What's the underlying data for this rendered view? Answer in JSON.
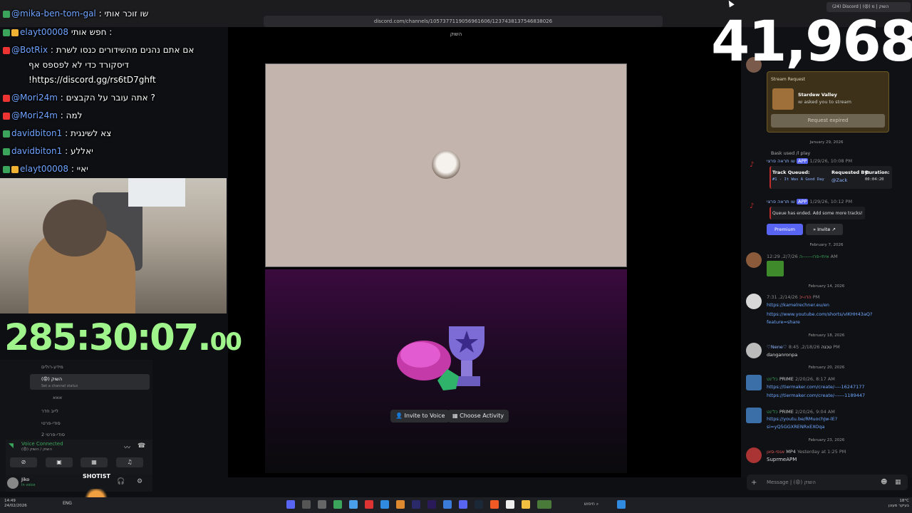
{
  "browser": {
    "url": "discord.com/channels/1057377119056961606/1237438137546838026",
    "tab_title": "(24) Discord | (😡) השוק | מ"
  },
  "voice": {
    "channel_header": "השוק",
    "invite_label": "Invite to Voice",
    "activity_label": "Choose Activity"
  },
  "overlay": {
    "counter": "41,968",
    "timer_main": "285:30:07.",
    "timer_frac": "00",
    "chat": [
      {
        "user": "@mika-ben-tom-gal",
        "text": ": שו זוכר אותי"
      },
      {
        "user": "elayt00008",
        "text": "חפש אותי :"
      },
      {
        "user": "@BotRix",
        "text": ": אם אתם נהנים מהשידורים כנסו לשרת"
      },
      {
        "user": "",
        "text": "דיסקורד כדי לא לפספס אף"
      },
      {
        "user": "",
        "text": "!https://discord.gg/rs6tD7ghft"
      },
      {
        "user": "@Mori24m",
        "text": ": אתה עובר על הקבצים ?"
      },
      {
        "user": "@Mori24m",
        "text": ": למה"
      },
      {
        "user": "davidbiton1",
        "text": ": צא לשינגית"
      },
      {
        "user": "davidbiton1",
        "text": ": יאללע"
      },
      {
        "user": "elayt00008",
        "text": ": יאיי"
      }
    ]
  },
  "chat": {
    "stream_request_title": "Stream Request",
    "stream_game": "Stardew Valley",
    "stream_asked": "שו asked you to stream",
    "request_expired": "Request expired",
    "dates": [
      "January 29, 2026",
      "February 7, 2026",
      "February 14, 2026",
      "February 18, 2026",
      "February 20, 2026",
      "February 23, 2026"
    ],
    "bask_used": "Bask used /l play",
    "bot_name": "שו תראה פרצי",
    "app_tag": "APP",
    "time1": "1/29/26, 10:08 PM",
    "time2": "1/29/26, 10:12 PM",
    "track_queued": "Track Queued:",
    "requested_by": "Requested By:",
    "duration": "Duration:",
    "track_name": "#1 - It Was A Good Day",
    "requester": "@Zack",
    "track_duration": "00:04:20",
    "queue_ended": "Queue has ended. Add some more tracks!",
    "premium": "Premium",
    "invite": "Invite",
    "user3": "איתי-פרו------ה",
    "time3": "2/7/26, 12:29 AM",
    "user4": "הדו-יכ",
    "time4": "2/14/26, 7:31 PM",
    "link1": "https://kamelrechner.eu/en",
    "link2": "https://www.youtube.com/shorts/vIKHH43aQ?",
    "link2b": "feature=share",
    "user5": "♡Nene♡",
    "tag5": "טכנה",
    "time5": "2/18/26, 8:45 PM",
    "msg5": "danganronpa",
    "user6": "כל'נט",
    "tag6": "PRIME",
    "time6": "2/20/26, 8:17 AM",
    "link3": "https://tiermaker.com/create/----16247177",
    "link4": "https://tiermaker.com/create/------1189447",
    "time7": "2/20/26, 9:04 AM",
    "link5": "https://youtu.be/RMuochJw-lE?",
    "link5b": "si=yQ5GGXRENRxEXOqa",
    "user8": "אנפי-סאן",
    "tag8": "MP4",
    "time8": "Yesterday at 1:25 PM",
    "msg8": "SuprmeAPM",
    "input_placeholder": "Message | (😡) השוק"
  },
  "sidebar": {
    "channels": [
      "מידע-רולים",
      "(😡) השוק",
      "Set a channel status",
      "אאא",
      "לייב חדר",
      "סודי-פרטי",
      "סודי-פרטי 2"
    ],
    "voice_connected": "Voice Connected",
    "voice_sub": "(😡) השוק / השוק",
    "user": "Jiko",
    "user_status": "In voice",
    "shotist": "SHOTIST"
  },
  "taskbar": {
    "time": "14:49",
    "date": "24/02/2026",
    "lang": "ENG",
    "search": "חיפוש",
    "weather": "18°C",
    "weather_sub": "בעיקר מעונן"
  },
  "colors": {
    "accent": "#5865f2",
    "timer": "#9ff58c",
    "discord_bg": "#101114"
  }
}
